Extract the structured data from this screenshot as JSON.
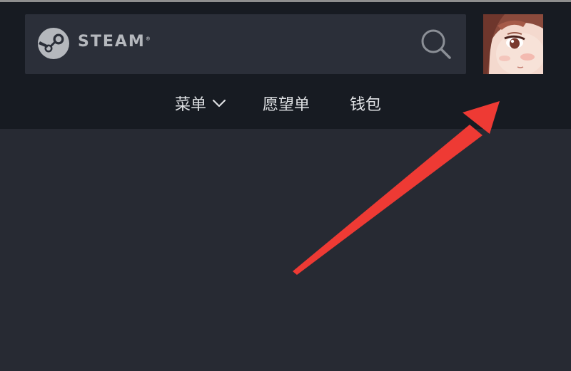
{
  "brand": {
    "wordmark": "STEAM",
    "trademark": "®"
  },
  "search": {
    "icon": "search-icon"
  },
  "avatar": {
    "icon": "user-avatar"
  },
  "nav": {
    "menu_label": "菜单",
    "wishlist_label": "愿望单",
    "wallet_label": "钱包"
  },
  "colors": {
    "header_bg": "#171b22",
    "page_bg": "#272a33",
    "search_bg": "#2b2f39",
    "arrow": "#ee3a34"
  }
}
